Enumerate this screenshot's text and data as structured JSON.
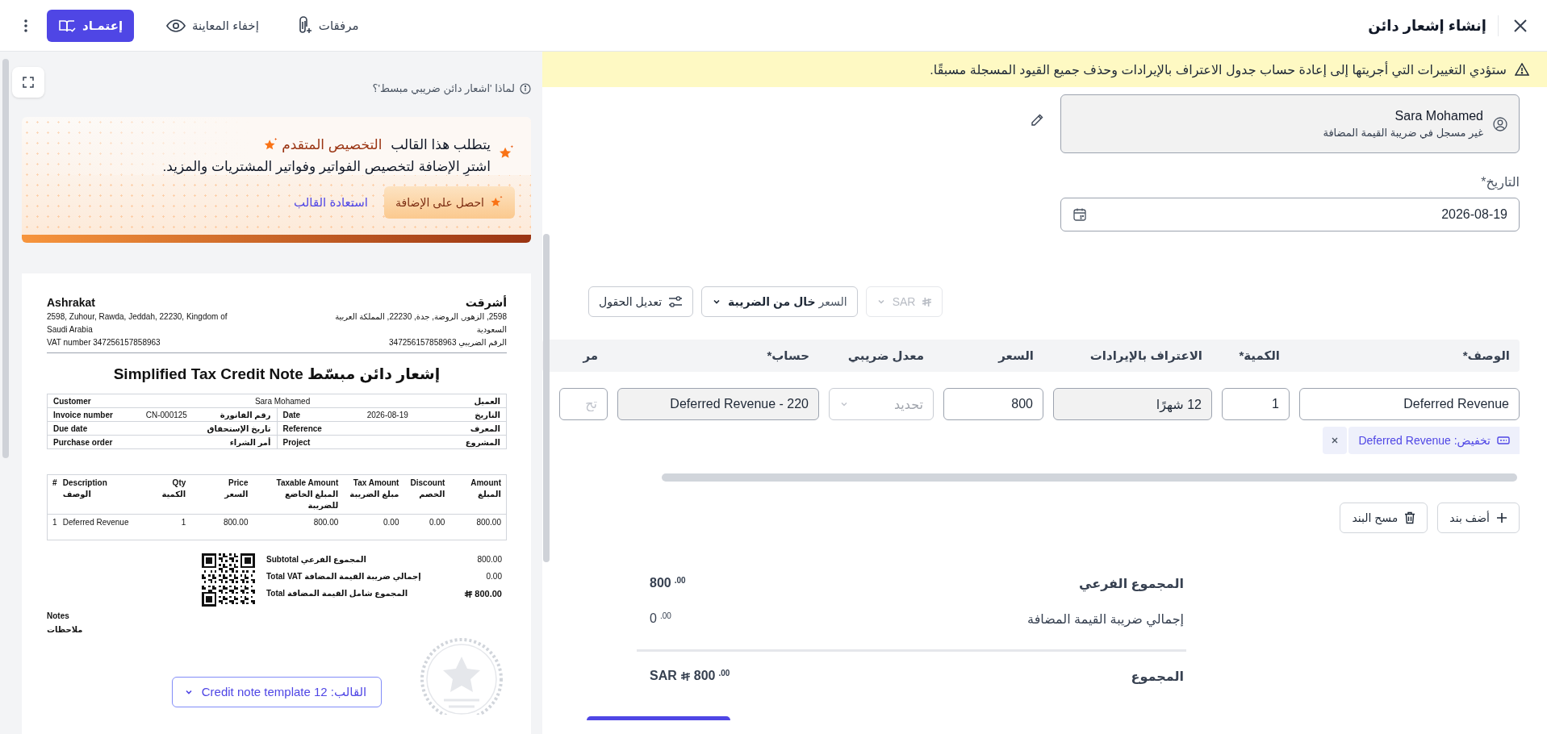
{
  "header": {
    "title": "إنشاء إشعار دائن",
    "actions": [
      {
        "kind": "attachments",
        "label": "مرفقات"
      },
      {
        "kind": "preview",
        "label": "إخفاء المعاينة"
      },
      {
        "kind": "approve",
        "label": "إعتمـاد"
      }
    ]
  },
  "preview": {
    "info_link": "لماذا 'اشعار دائن ضريبي مبسط'؟",
    "promo": {
      "line1": "يتطلب هذا القالب **التخصيص المتقدم**",
      "line2": "اشترِ الإضافة لتخصيص الفواتير وفواتير المشتريات والمزيد.",
      "buy_button": "احصل على الإضافة",
      "restore_link": "استعادة القالب"
    },
    "document": {
      "company_en": {
        "name": "Ashrakat",
        "address": "2598, Zuhour, Rawda, Jeddah, 22230, Kingdom of Saudi Arabia",
        "vat": "VAT number 347256157858963"
      },
      "company_ar": {
        "name": "أشرقت",
        "address": "2598, الزهور, الروضة, جدة, 22230, المملكة العربية السعودية",
        "vat": "الرقم الضريبي 347256157858963"
      },
      "title": "Simplified Tax Credit Note إشعار دائن مبسّط",
      "customer": {
        "label_en": "Customer",
        "value": "Sara Mohamed",
        "label_ar": "العميل"
      },
      "info_rows": [
        [
          {
            "label_en": "Date",
            "value": "2026-08-19",
            "label_ar": "التاريخ"
          },
          {
            "label_en": "Invoice number",
            "value": "CN-000125",
            "label_ar": "رقم الفاتورة"
          }
        ],
        [
          {
            "label_en": "Reference",
            "label_ar": "المعرف"
          },
          {
            "label_en": "Due date",
            "label_ar": "تاريخ الإستحقاق"
          }
        ],
        [
          {
            "label_en": "Project",
            "label_ar": "المشروع"
          },
          {
            "label_en": "Purchase order",
            "label_ar": "أمر الشراء"
          }
        ]
      ],
      "columns": [
        {
          "en": "Amount",
          "ar": "المبلغ"
        },
        {
          "en": "Discount",
          "ar": "الخصم"
        },
        {
          "en": "Tax Amount",
          "ar": "مبلغ الضريبة"
        },
        {
          "en": "Taxable Amount",
          "ar": "المبلغ الخاضع للضريبة"
        },
        {
          "en": "Price",
          "ar": "السعر"
        },
        {
          "en": "Qty",
          "ar": "الكمية"
        },
        {
          "en": "Description",
          "ar": "الوصف"
        },
        {
          "en": "#"
        }
      ],
      "rows": [
        [
          "800.00",
          "0.00",
          "0.00",
          "800.00",
          "800.00",
          "1",
          "Deferred Revenue",
          "1"
        ]
      ],
      "totals": [
        {
          "kind": "plain",
          "label": "Subtotal المجموع الفرعي",
          "value": "800.00"
        },
        {
          "kind": "plain",
          "label": "Total VAT إجمالي ضريبة القيمة المضافة",
          "value": "0.00"
        },
        {
          "kind": "grand",
          "label": "Total المجموع شامل القيمة المضافة",
          "value": "800.00"
        }
      ],
      "notes_en": "Notes",
      "notes_ar": "ملاحظات"
    },
    "template_selector": "القالب: Credit note template 12"
  },
  "form": {
    "warning": "ستؤدي التغييرات التي أجريتها إلى إعادة حساب جدول الاعتراف بالإيرادات وحذف جميع القيود المسجلة مسبقًا.",
    "customer": {
      "name": "Sara Mohamed",
      "vat_status": "غير مسجل في ضريبة القيمة المضافة"
    },
    "date": {
      "label": "التاريخ*",
      "value": "2026-08-19"
    },
    "currency": {
      "label": "SAR",
      "disabled": true
    },
    "price_mode": "السعر **خال من الضريبة**",
    "edit_fields": "تعديل الحقول",
    "table": {
      "columns": [
        "الوصف*",
        "الكمية*",
        "الاعتراف بالإيرادات",
        "السعر",
        "معدل ضريبي",
        "حساب*",
        "مر"
      ],
      "rows": [
        {
          "cells": [
            {
              "kind": "input",
              "value": "Deferred Revenue"
            },
            {
              "kind": "input",
              "value": "1"
            },
            {
              "kind": "readonly",
              "value": "12 شهرًا"
            },
            {
              "kind": "input",
              "value": "800"
            },
            {
              "kind": "select",
              "placeholder": "تحديد"
            },
            {
              "kind": "readonly",
              "value": "Deferred Revenue - 220"
            },
            {
              "kind": "input",
              "placeholder": "تح"
            }
          ],
          "tag": "تخفيض: Deferred Revenue"
        }
      ]
    },
    "add_line": "أضف بند",
    "clear_line": "مسح البند",
    "totals": [
      {
        "kind": "bold",
        "label": "المجموع الفرعي",
        "value": "800",
        "fraction": ".00"
      },
      {
        "kind": "plain",
        "label": "إجمالي ضريبة القيمة المضافة",
        "value": "0",
        "fraction": ".00"
      },
      {
        "kind": "grand",
        "label": "المجموع",
        "value": "800",
        "fraction": ".00",
        "currency": "SAR"
      }
    ]
  }
}
